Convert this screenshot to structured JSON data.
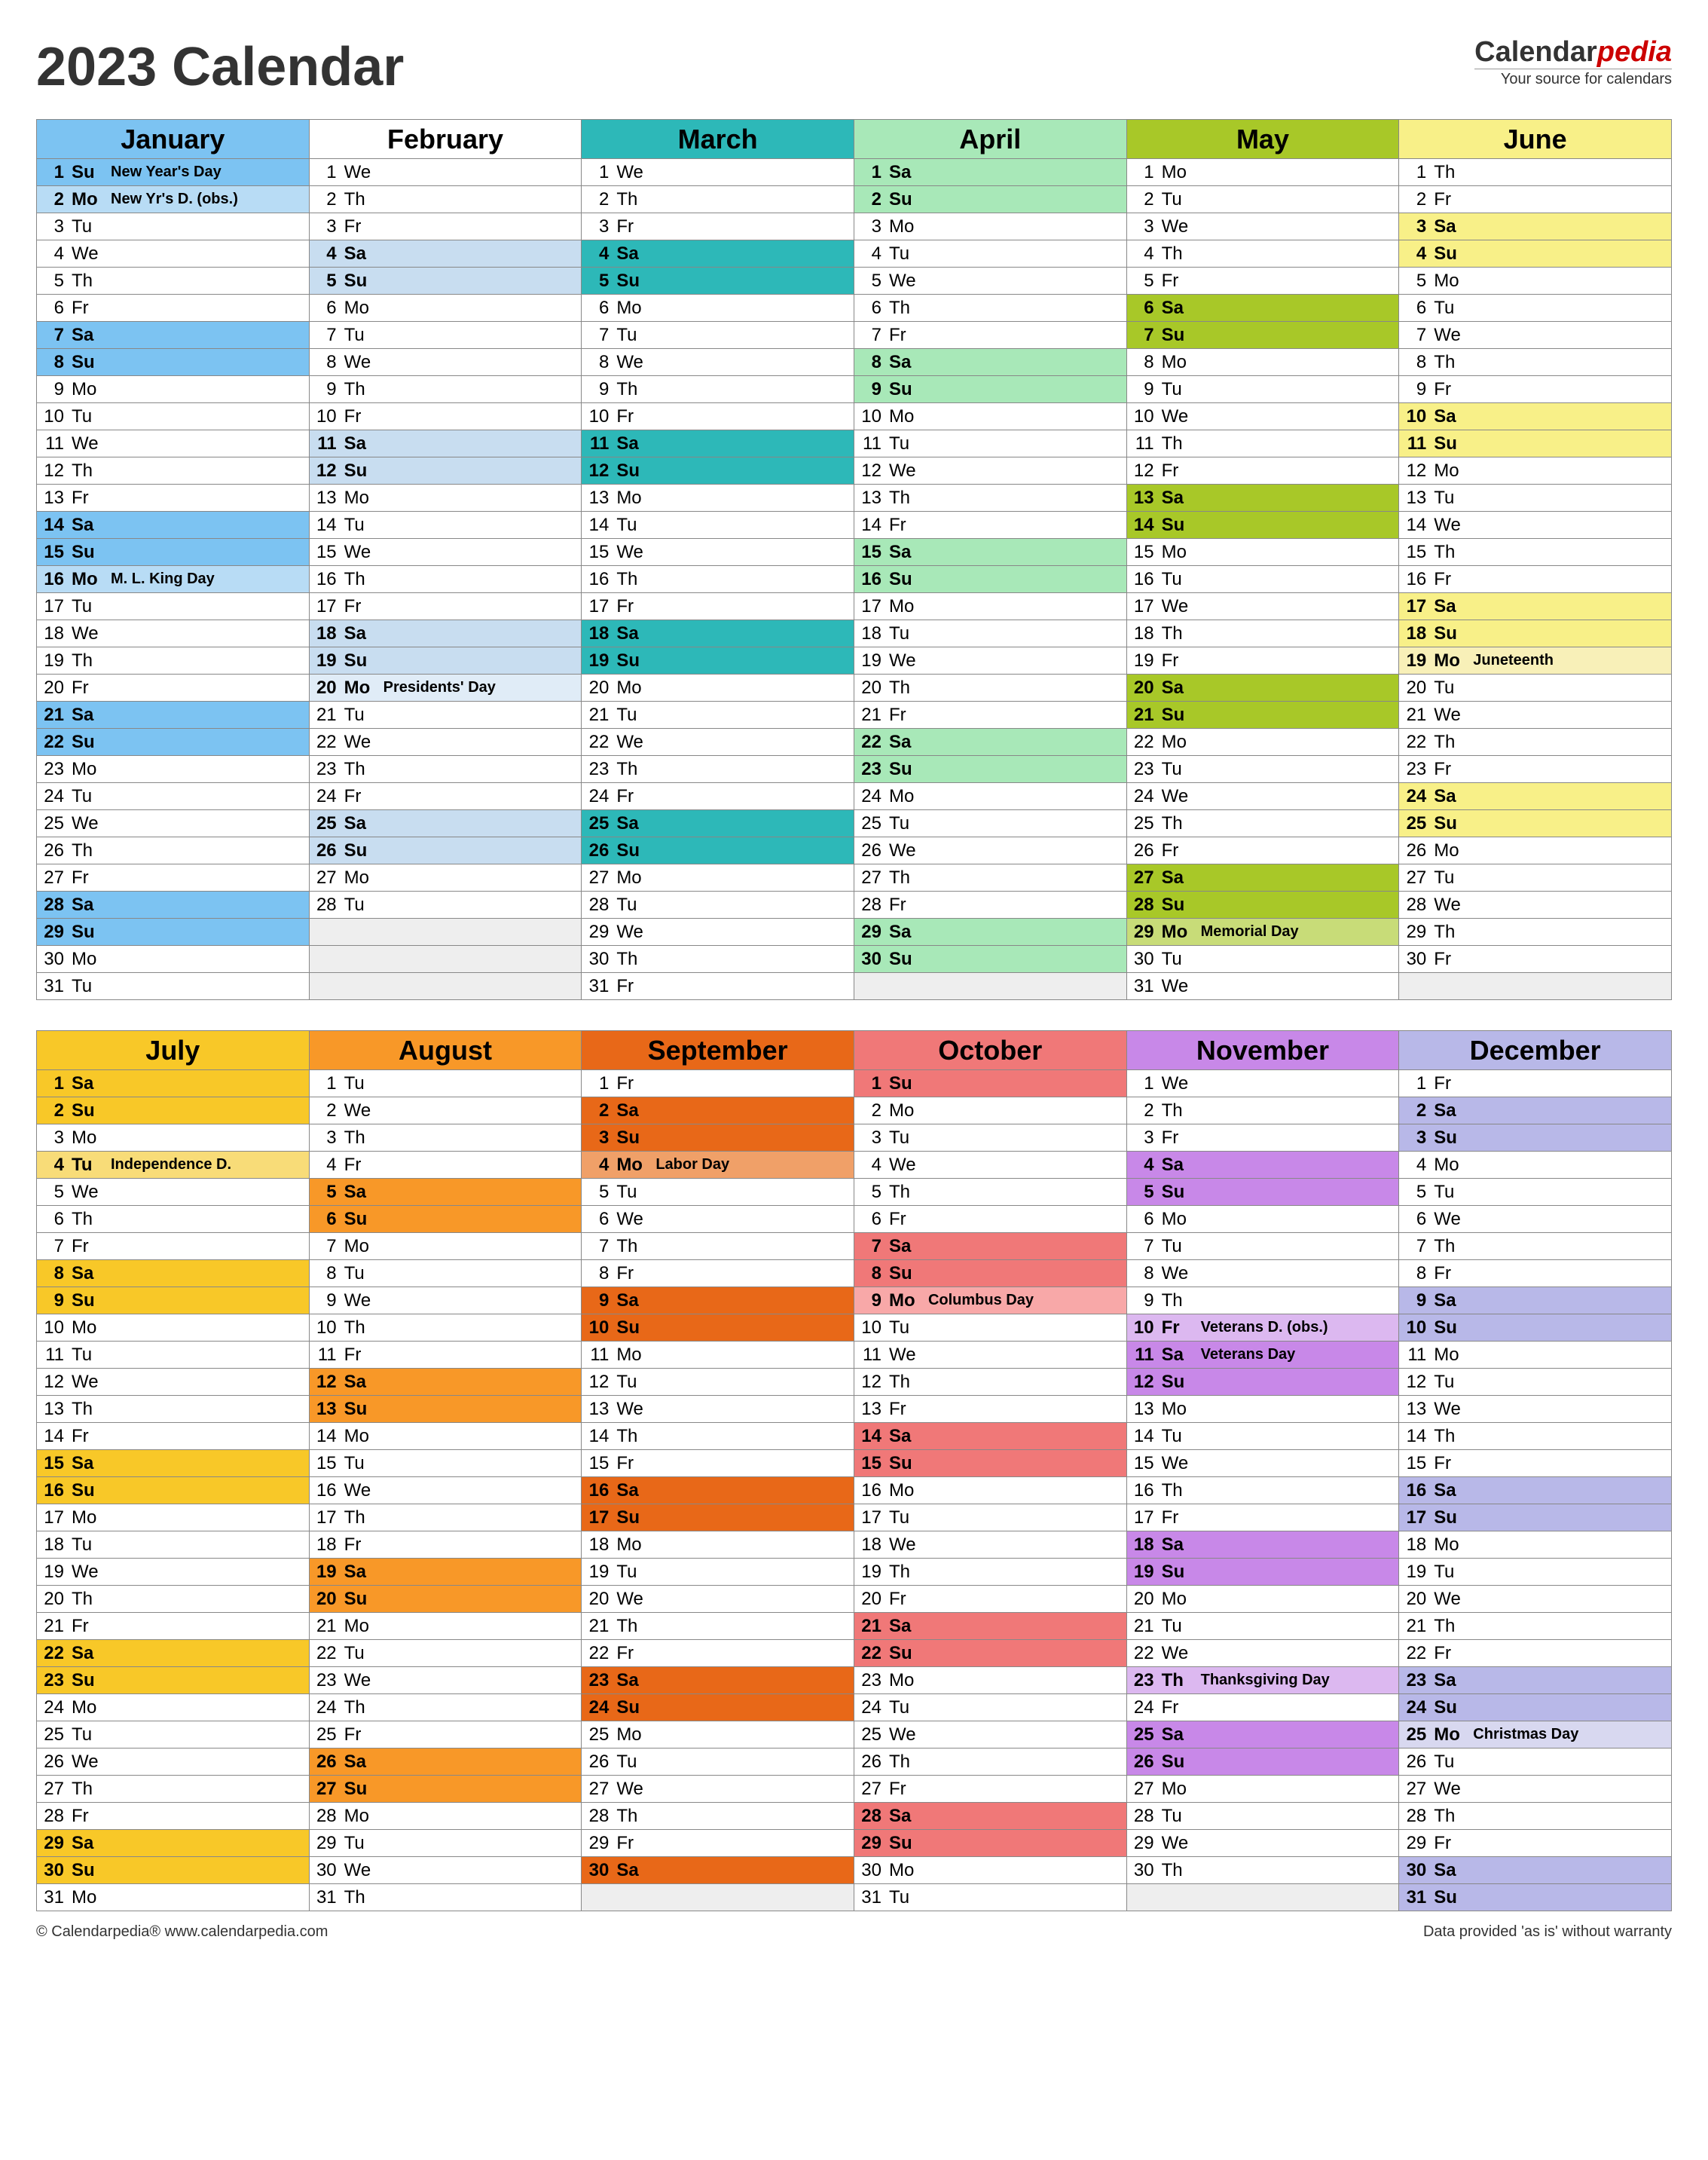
{
  "title": "2023 Calendar",
  "brand": {
    "name1": "Calendar",
    "name2": "pedia",
    "tagline": "Your source for calendars"
  },
  "footer": {
    "left": "© Calendarpedia®   www.calendarpedia.com",
    "right": "Data provided 'as is' without warranty"
  },
  "dow": [
    "Su",
    "Mo",
    "Tu",
    "We",
    "Th",
    "Fr",
    "Sa"
  ],
  "colors": {
    "January": {
      "h": "#7cc3f2",
      "w": "#7cc3f2",
      "wl": "#b8dcf5"
    },
    "February": {
      "h": "#fff",
      "w": "#c8ddf0",
      "wl": "#e0ecf7"
    },
    "March": {
      "h": "#2db8b8",
      "w": "#2db8b8",
      "wl": "#7fd0d0"
    },
    "April": {
      "h": "#a8e8b8",
      "w": "#a8e8b8",
      "wl": "#c8f0d0"
    },
    "May": {
      "h": "#a8c828",
      "w": "#a8c828",
      "wl": "#c8dc78"
    },
    "June": {
      "h": "#f8f088",
      "w": "#f8f088",
      "wl": "#f8f0b8"
    },
    "July": {
      "h": "#f8c828",
      "w": "#f8c828",
      "wl": "#f8dc78"
    },
    "August": {
      "h": "#f89828",
      "w": "#f89828",
      "wl": "#f8c078"
    },
    "September": {
      "h": "#e86818",
      "w": "#e86818",
      "wl": "#f0a068"
    },
    "October": {
      "h": "#f07878",
      "w": "#f07878",
      "wl": "#f8a8a8"
    },
    "November": {
      "h": "#c888e8",
      "w": "#c888e8",
      "wl": "#dcb8f0"
    },
    "December": {
      "h": "#b8b8e8",
      "w": "#b8b8e8",
      "wl": "#d8d8f0"
    }
  },
  "months": [
    {
      "name": "January",
      "start": 0,
      "len": 31
    },
    {
      "name": "February",
      "start": 3,
      "len": 28
    },
    {
      "name": "March",
      "start": 3,
      "len": 31
    },
    {
      "name": "April",
      "start": 6,
      "len": 30
    },
    {
      "name": "May",
      "start": 1,
      "len": 31
    },
    {
      "name": "June",
      "start": 4,
      "len": 30
    },
    {
      "name": "July",
      "start": 6,
      "len": 31
    },
    {
      "name": "August",
      "start": 2,
      "len": 31
    },
    {
      "name": "September",
      "start": 5,
      "len": 30
    },
    {
      "name": "October",
      "start": 0,
      "len": 31
    },
    {
      "name": "November",
      "start": 3,
      "len": 30
    },
    {
      "name": "December",
      "start": 5,
      "len": 31
    }
  ],
  "holidays": {
    "January": {
      "1": "New Year's Day",
      "2": "New Yr's D. (obs.)",
      "16": "M. L. King Day"
    },
    "February": {
      "20": "Presidents' Day"
    },
    "May": {
      "29": "Memorial Day"
    },
    "June": {
      "19": "Juneteenth"
    },
    "July": {
      "4": "Independence D."
    },
    "September": {
      "4": "Labor Day"
    },
    "October": {
      "9": "Columbus Day"
    },
    "November": {
      "10": "Veterans D. (obs.)",
      "11": "Veterans Day",
      "23": "Thanksgiving Day"
    },
    "December": {
      "25": "Christmas Day"
    }
  }
}
